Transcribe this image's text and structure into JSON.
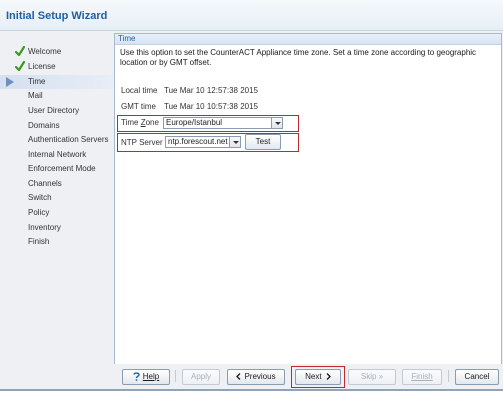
{
  "window": {
    "title": "Initial Setup Wizard"
  },
  "sidebar": {
    "items": [
      {
        "label": "Welcome",
        "done": true
      },
      {
        "label": "License",
        "done": true
      },
      {
        "label": "Time",
        "active": true
      },
      {
        "label": "Mail"
      },
      {
        "label": "User Directory"
      },
      {
        "label": "Domains"
      },
      {
        "label": "Authentication Servers"
      },
      {
        "label": "Internal Network"
      },
      {
        "label": "Enforcement Mode"
      },
      {
        "label": "Channels"
      },
      {
        "label": "Switch"
      },
      {
        "label": "Policy"
      },
      {
        "label": "Inventory"
      },
      {
        "label": "Finish"
      }
    ]
  },
  "panel": {
    "title": "Time",
    "description": "Use this option to set the CounterACT Appliance time zone. Set a time zone according to geographic location or by GMT offset.",
    "local_time": {
      "label": "Local time",
      "value": "Tue Mar 10 12:57:38 2015"
    },
    "gmt_time": {
      "label": "GMT time",
      "value": "Tue Mar 10 10:57:38 2015"
    },
    "time_zone": {
      "label_prefix": "Time ",
      "label_accel": "Z",
      "label_suffix": "one",
      "value": "Europe/Istanbul"
    },
    "ntp_server": {
      "label": "NTP Server",
      "value": "ntp.forescout.net",
      "test_label": "Test"
    }
  },
  "footer": {
    "help_label": "Help",
    "apply_label": "Apply",
    "previous_label": "Previous",
    "next_label": "Next",
    "skip_label": "Skip",
    "finish_label": "Finish",
    "cancel_label": "Cancel"
  },
  "colors": {
    "accent": "#1c5fa5",
    "highlight": "#c0282d",
    "check": "#3a9a1e"
  }
}
